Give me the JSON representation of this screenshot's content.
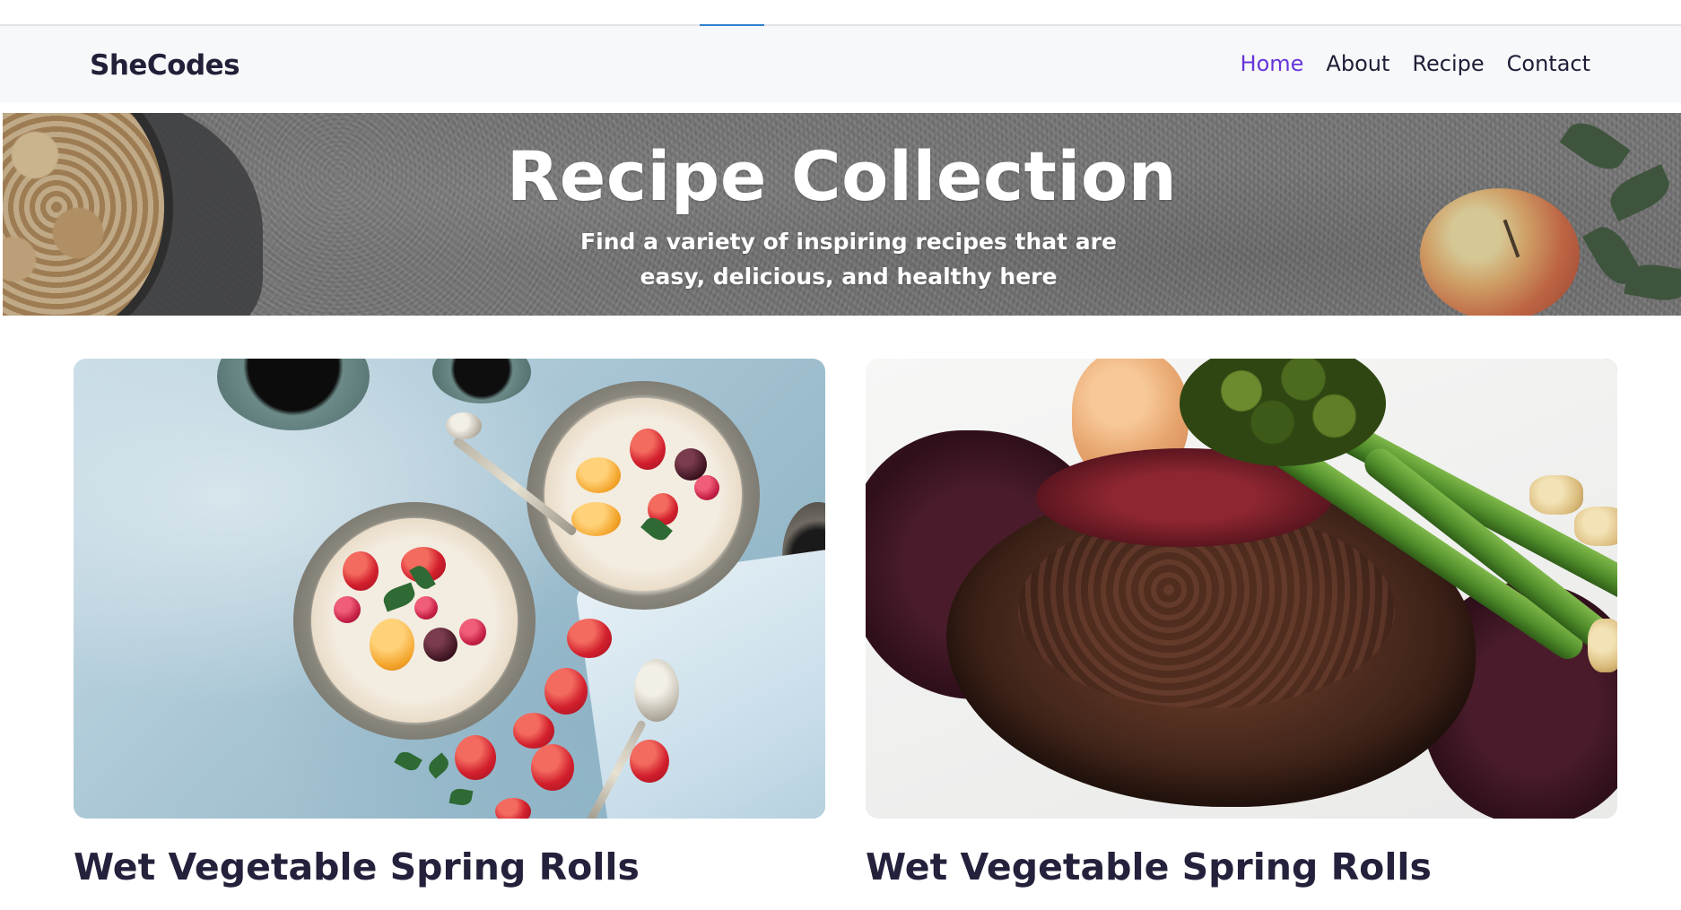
{
  "navbar": {
    "brand": "SheCodes",
    "links": [
      {
        "label": "Home",
        "active": true
      },
      {
        "label": "About",
        "active": false
      },
      {
        "label": "Recipe",
        "active": false
      },
      {
        "label": "Contact",
        "active": false
      }
    ]
  },
  "hero": {
    "title": "Recipe Collection",
    "subtitle": "Find a variety of inspiring recipes that are easy, delicious, and healthy here"
  },
  "cards": [
    {
      "title": "Wet Vegetable Spring Rolls",
      "image": "breakfast-bowls-photo"
    },
    {
      "title": "Wet Vegetable Spring Rolls",
      "image": "steak-broccolini-photo"
    }
  ],
  "colors": {
    "accent": "#6636d9",
    "text_dark": "#23213b",
    "navbar_bg": "#f7f8fa"
  }
}
